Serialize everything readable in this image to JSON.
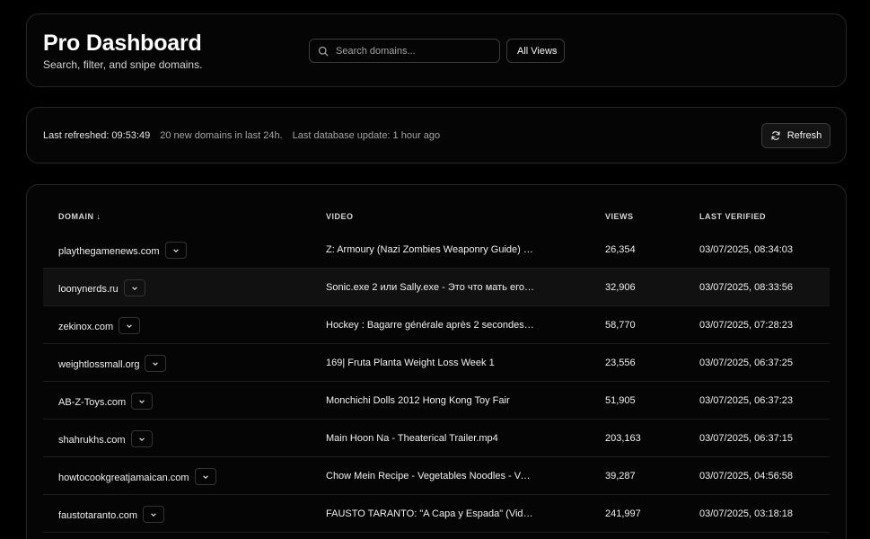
{
  "header": {
    "title": "Pro Dashboard",
    "subtitle": "Search, filter, and snipe domains.",
    "search_placeholder": "Search domains...",
    "views_filter": "All Views"
  },
  "status": {
    "last_refreshed": "Last refreshed: 09:53:49",
    "new_domains": "20 new domains in last 24h.",
    "db_update": "Last database update: 1 hour ago",
    "refresh_label": "Refresh"
  },
  "table": {
    "columns": {
      "domain": "DOMAIN ↓",
      "video": "VIDEO",
      "views": "VIEWS",
      "verified": "LAST VERIFIED"
    },
    "rows": [
      {
        "domain": "playthegamenews.com",
        "video": "Z: Armoury (Nazi Zombies Weaponry Guide) - T...",
        "views": "26,354",
        "verified": "03/07/2025, 08:34:03"
      },
      {
        "domain": "loonynerds.ru",
        "video": "Sonic.exe 2 или Sally.exe - Это что мать его б...",
        "views": "32,906",
        "verified": "03/07/2025, 08:33:56"
      },
      {
        "domain": "zekinox.com",
        "video": "Hockey : Bagarre générale après 2 secondes de...",
        "views": "58,770",
        "verified": "03/07/2025, 07:28:23"
      },
      {
        "domain": "weightlossmall.org",
        "video": "169| Fruta Planta Weight Loss Week 1",
        "views": "23,556",
        "verified": "03/07/2025, 06:37:25"
      },
      {
        "domain": "AB-Z-Toys.com",
        "video": "Monchichi Dolls 2012 Hong Kong Toy Fair",
        "views": "51,905",
        "verified": "03/07/2025, 06:37:23"
      },
      {
        "domain": "shahrukhs.com",
        "video": "Main Hoon Na - Theaterical Trailer.mp4",
        "views": "203,163",
        "verified": "03/07/2025, 06:37:15"
      },
      {
        "domain": "howtocookgreatjamaican.com",
        "video": "Chow Mein Recipe - Vegetables Noodles - Veg...",
        "views": "39,287",
        "verified": "03/07/2025, 04:56:58"
      },
      {
        "domain": "faustotaranto.com",
        "video": "FAUSTO TARANTO: \"A Capa y Espada\" (Videocl...",
        "views": "241,997",
        "verified": "03/07/2025, 03:18:18"
      }
    ]
  },
  "colors": {
    "background": "#000000",
    "card": "#050505",
    "border": "#262626",
    "highlight_row": "#111111"
  },
  "icons": [
    "search-icon",
    "chevron-down-icon",
    "refresh-icon"
  ]
}
